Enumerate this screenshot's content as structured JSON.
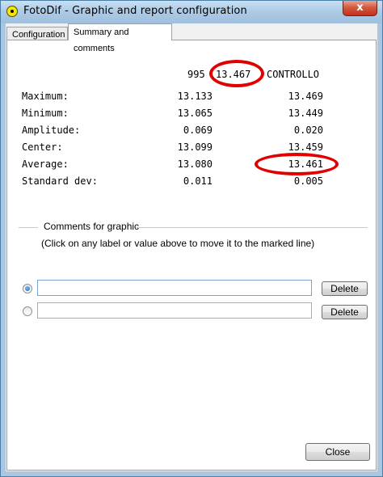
{
  "window": {
    "title": "FotoDif - Graphic and report configuration",
    "close_glyph": "x",
    "icon": "app-logo-icon"
  },
  "tabs": [
    {
      "label": "Configuration",
      "active": false
    },
    {
      "label": "Summary and comments",
      "active": true
    }
  ],
  "summary": {
    "header": {
      "code": "995",
      "value": "13.467",
      "name": "CONTROLLO"
    },
    "rows": [
      {
        "label": "Maximum:",
        "value1": "13.133",
        "value2": "13.469"
      },
      {
        "label": "Minimum:",
        "value1": "13.065",
        "value2": "13.449"
      },
      {
        "label": "Amplitude:",
        "value1": "0.069",
        "value2": "0.020"
      },
      {
        "label": "Center:",
        "value1": "13.099",
        "value2": "13.459"
      },
      {
        "label": "Average:",
        "value1": "13.080",
        "value2": "13.461"
      },
      {
        "label": "Standard dev:",
        "value1": "0.011",
        "value2": "0.005"
      }
    ],
    "highlight_color": "#e00000"
  },
  "comments": {
    "group_title": "Comments for graphic",
    "hint": "(Click on any label or value above to move it to the marked line)",
    "lines": [
      {
        "selected": true,
        "value": "",
        "delete_label": "Delete"
      },
      {
        "selected": false,
        "value": "",
        "delete_label": "Delete"
      }
    ]
  },
  "footer": {
    "close_label": "Close"
  }
}
